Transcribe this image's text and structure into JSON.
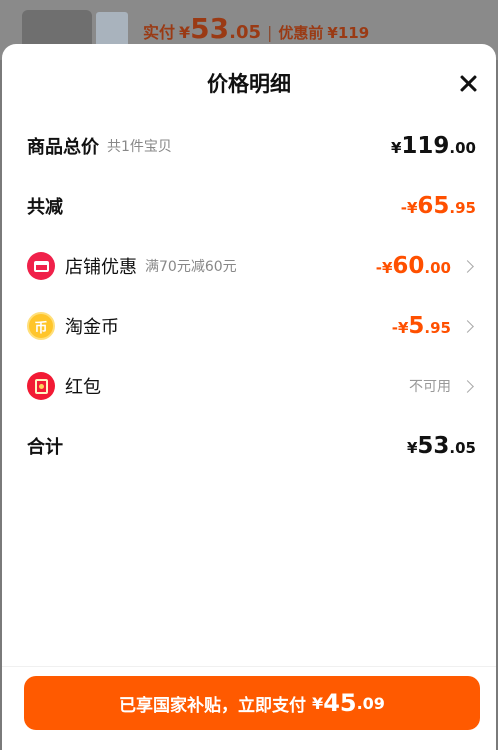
{
  "background": {
    "pay_label": "实付",
    "pay_yen": "¥",
    "pay_int": "53",
    "pay_dec": ".05",
    "separator": "|",
    "before_label": "优惠前",
    "before_price": "¥119"
  },
  "sheet": {
    "title": "价格明细",
    "close_icon": "close-icon"
  },
  "rows": {
    "total": {
      "label": "商品总价",
      "sub": "共1件宝贝",
      "yen": "¥",
      "int": "119",
      "dec": ".00"
    },
    "reduced": {
      "label": "共减",
      "yen": "-¥",
      "int": "65",
      "dec": ".95"
    },
    "store": {
      "icon": "store-icon",
      "label": "店铺优惠",
      "sub": "满70元减60元",
      "yen": "-¥",
      "int": "60",
      "dec": ".00"
    },
    "coin": {
      "icon": "coin-icon",
      "icon_glyph": "币",
      "label": "淘金币",
      "yen": "-¥",
      "int": "5",
      "dec": ".95"
    },
    "redpacket": {
      "icon": "red-packet-icon",
      "label": "红包",
      "status": "不可用"
    },
    "sum": {
      "label": "合计",
      "yen": "¥",
      "int": "53",
      "dec": ".05"
    }
  },
  "pay_button": {
    "text": "已享国家补贴，立即支付",
    "yen": "¥",
    "int": "45",
    "dec": ".09"
  },
  "colors": {
    "accent": "#ff5000",
    "button": "#ff5a00",
    "store_icon": "#f0214a",
    "coin_icon": "#ffc52a"
  }
}
